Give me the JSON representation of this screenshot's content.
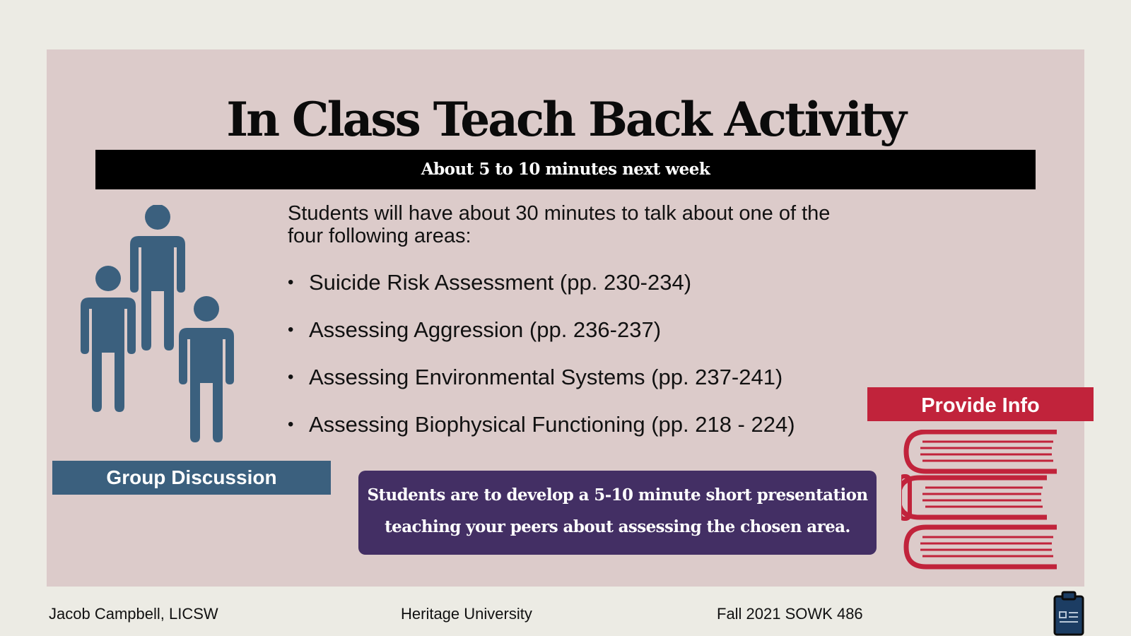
{
  "slide": {
    "title": "In Class Teach Back Activity",
    "subtitle": "About 5 to 10 minutes next week",
    "intro": "Students will have about 30 minutes to talk about one of the four following areas:",
    "areas": [
      "Suicide Risk Assessment (pp. 230-234)",
      "Assessing Aggression (pp. 236-237)",
      "Assessing Environmental Systems (pp. 237-241)",
      "Assessing Biophysical Functioning (pp. 218 - 224)"
    ],
    "group_label": "Group Discussion",
    "provide_label": "Provide Info",
    "task_line1": "Students are to develop a 5-10 minute short presentation",
    "task_line2": "teaching your peers about assessing the chosen area."
  },
  "footer": {
    "author": "Jacob Campbell, LICSW",
    "institution": "Heritage University",
    "course": "Fall 2021 SOWK 486"
  },
  "icons": {
    "people": "people-group-icon",
    "books": "book-stack-icon",
    "clipboard": "clipboard-icon"
  },
  "colors": {
    "background": "#ecebe4",
    "panel": "#dccbca",
    "people_blue": "#3b607e",
    "task_purple": "#432f64",
    "books_red": "#c1233b"
  }
}
